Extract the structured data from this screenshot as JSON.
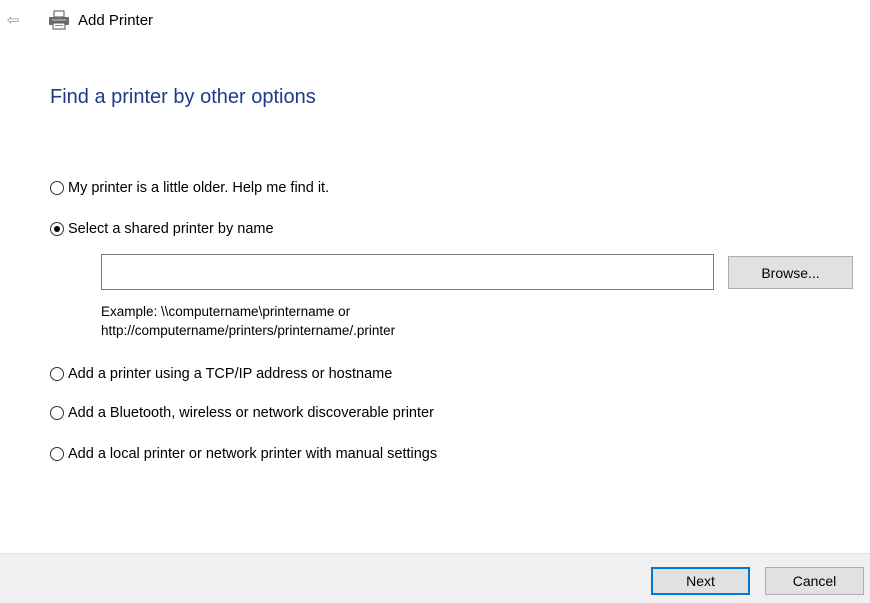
{
  "header": {
    "back_icon": "back-arrow-icon",
    "printer_icon": "printer-icon",
    "title": "Add Printer"
  },
  "main": {
    "heading": "Find a printer by other options",
    "options": [
      {
        "label": "My printer is a little older. Help me find it.",
        "checked": false
      },
      {
        "label": "Select a shared printer by name",
        "checked": true
      },
      {
        "label": "Add a printer using a TCP/IP address or hostname",
        "checked": false
      },
      {
        "label": "Add a Bluetooth, wireless or network discoverable printer",
        "checked": false
      },
      {
        "label": "Add a local printer or network printer with manual settings",
        "checked": false
      }
    ],
    "shared_printer_input": {
      "value": "",
      "placeholder": ""
    },
    "browse_label": "Browse...",
    "example_line1": "Example: \\\\computername\\printername or",
    "example_line2": "http://computername/printers/printername/.printer"
  },
  "footer": {
    "next_label": "Next",
    "cancel_label": "Cancel"
  },
  "colors": {
    "heading": "#1e3a8a",
    "default_button_border": "#0078d7",
    "footer_background": "#f0f0f0"
  }
}
